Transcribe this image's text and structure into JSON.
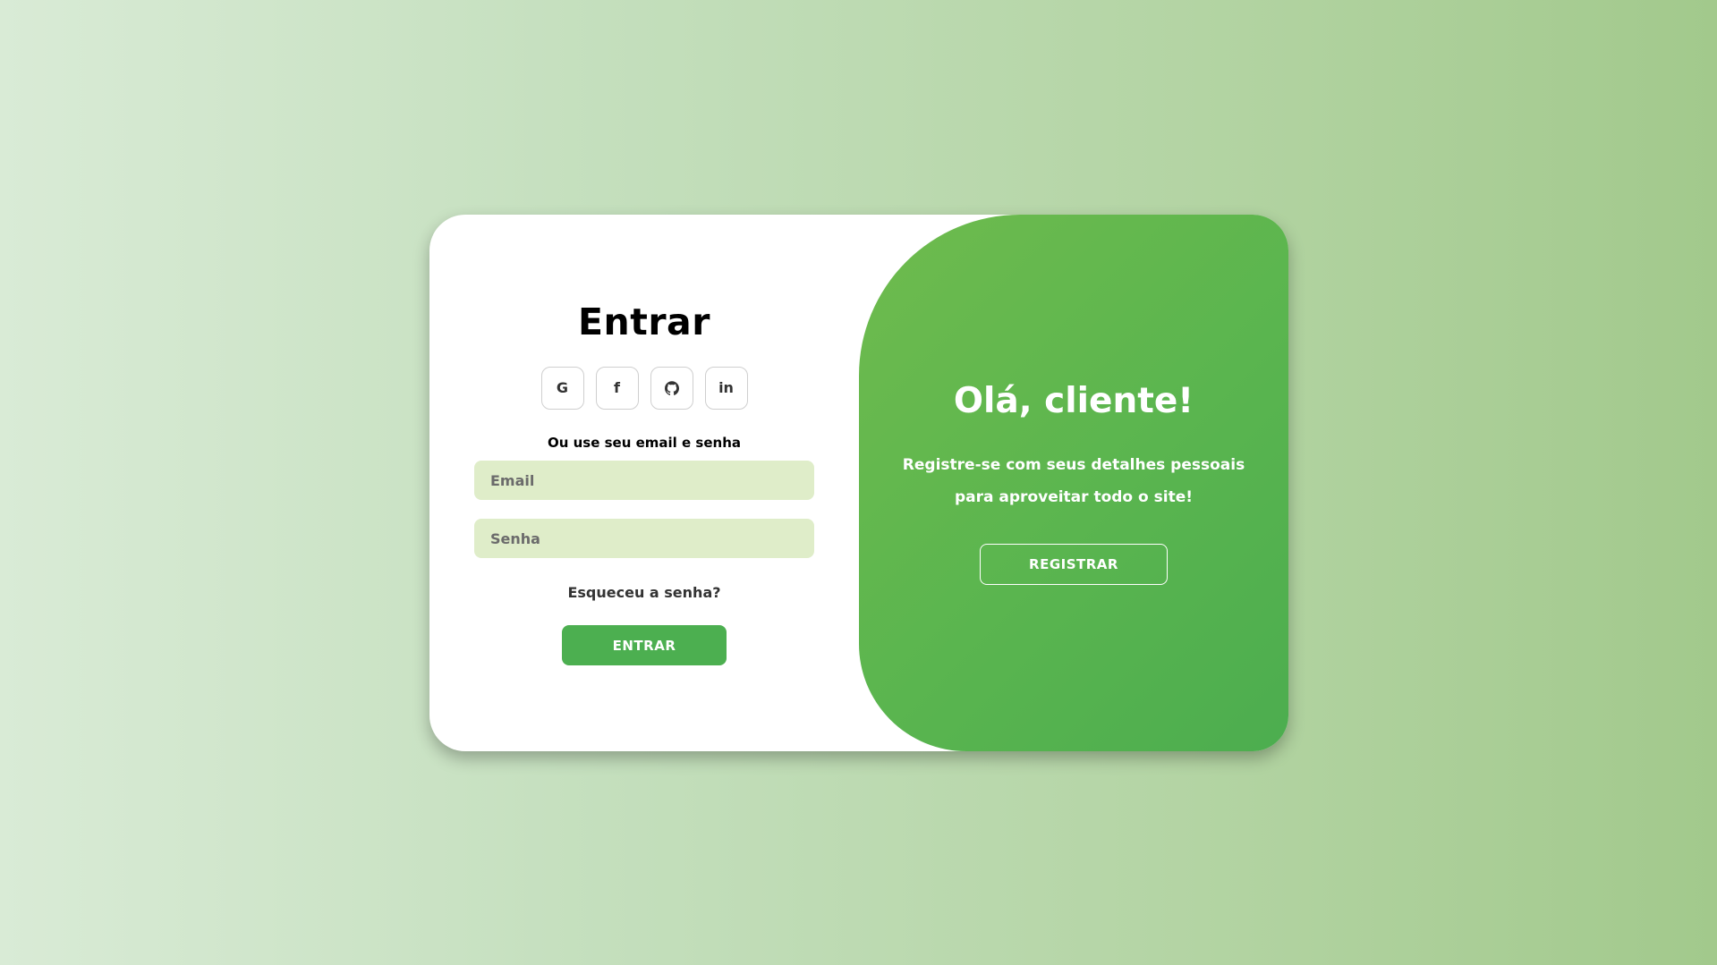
{
  "signin": {
    "title": "Entrar",
    "social_buttons": [
      {
        "icon": "google-icon",
        "glyph": "G"
      },
      {
        "icon": "facebook-icon",
        "glyph": "f"
      },
      {
        "icon": "github-icon",
        "glyph": ""
      },
      {
        "icon": "linkedin-icon",
        "glyph": "in"
      }
    ],
    "or_text": "Ou use seu email e senha",
    "email_placeholder": "Email",
    "password_placeholder": "Senha",
    "forgot_label": "Esqueceu a senha?",
    "submit_label": "ENTRAR"
  },
  "welcome": {
    "title": "Olá, cliente!",
    "text_line1": "Registre-se com seus detalhes pessoais",
    "text_line2": "para aproveitar todo o site!",
    "register_label": "REGISTRAR"
  },
  "colors": {
    "accent": "#4caf50",
    "input_bg": "#dfedc9",
    "panel_gradient_start": "#6fbb4d",
    "panel_gradient_end": "#4cad4f"
  }
}
